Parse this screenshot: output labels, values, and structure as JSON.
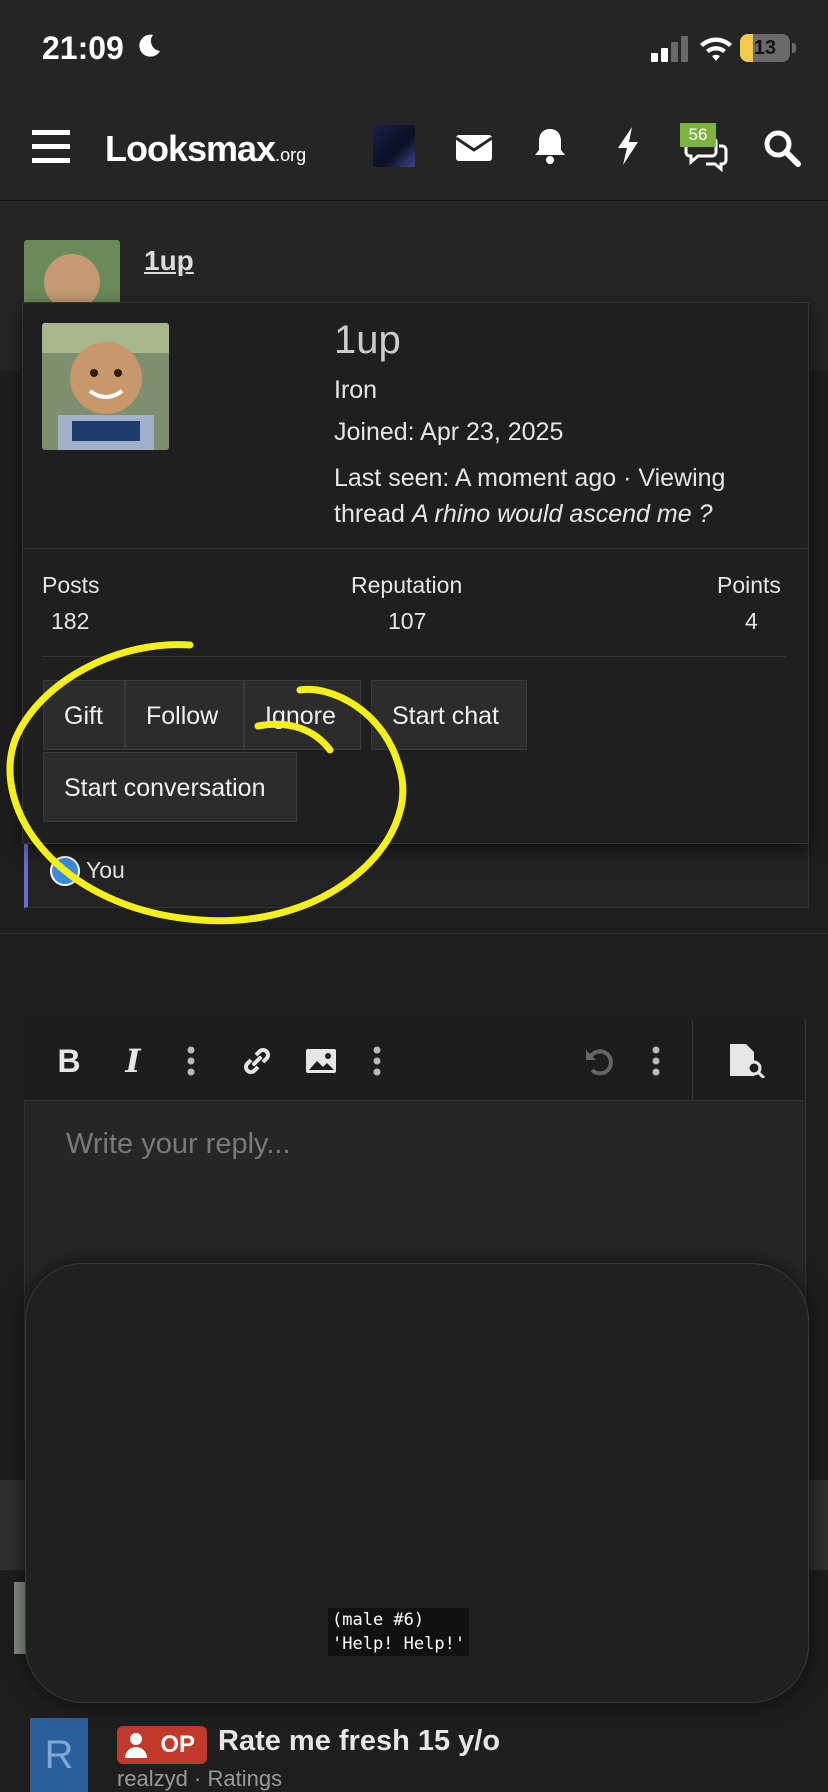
{
  "status_bar": {
    "time": "21:09",
    "battery": "13"
  },
  "nav": {
    "logo_main": "Looksmax",
    "logo_suffix": ".org",
    "chat_badge": "56"
  },
  "post": {
    "username": "1up"
  },
  "popup": {
    "name": "1up",
    "rank": "Iron",
    "joined": "Joined: Apr 23, 2025",
    "last_seen_prefix": "Last seen: A moment ago · Viewing thread ",
    "last_seen_thread": "A rhino would ascend me ?",
    "stats": {
      "posts_label": "Posts",
      "posts_value": "182",
      "reputation_label": "Reputation",
      "reputation_value": "107",
      "points_label": "Points",
      "points_value": "4"
    },
    "buttons": {
      "gift": "Gift",
      "follow": "Follow",
      "ignore": "Ignore",
      "start_chat": "Start chat",
      "start_conversation": "Start conversation"
    }
  },
  "reactions": {
    "user": "You"
  },
  "editor": {
    "placeholder": "Write your reply..."
  },
  "recommendation": {
    "avatar_letter": "R",
    "tag": "OP",
    "title": "Rate me fresh 15 y/o",
    "meta": "realzyd · Ratings"
  },
  "overlay": {
    "caption": "(male #6)\n'Help! Help!'"
  },
  "colors": {
    "background": "#1e1e1e",
    "header": "#252525",
    "badge": "#7db340",
    "op_tag": "#c0392b",
    "annotation": "#f5ef1a",
    "reaction_border": "#6b6fc6"
  }
}
